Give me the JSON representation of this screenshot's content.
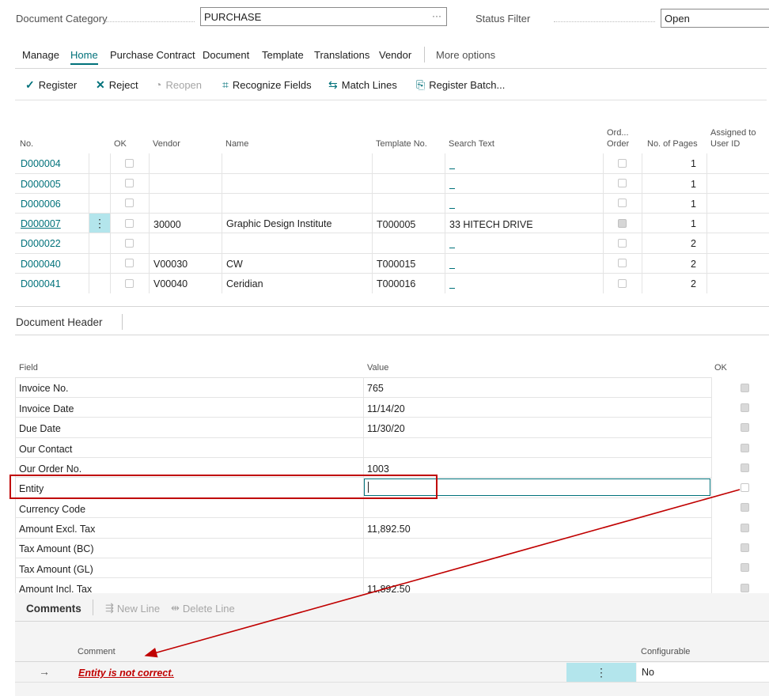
{
  "filters": {
    "doc_category_label": "Document Category",
    "doc_category_value": "PURCHASE",
    "doc_category_more": "···",
    "status_filter_label": "Status Filter",
    "status_filter_value": "Open"
  },
  "tabs": [
    "Manage",
    "Home",
    "Purchase Contract",
    "Document",
    "Template",
    "Translations",
    "Vendor",
    "More options"
  ],
  "active_tab": "Home",
  "actions": {
    "register": "Register",
    "reject": "Reject",
    "reopen": "Reopen",
    "recognize_fields": "Recognize Fields",
    "match_lines": "Match Lines",
    "register_batch": "Register Batch..."
  },
  "documents_table": {
    "headers": {
      "no": "No.",
      "ok": "OK",
      "vendor": "Vendor",
      "name": "Name",
      "template_no": "Template No.",
      "search_text": "Search Text",
      "order_top": "Ord...",
      "order_bottom": "Order",
      "no_of_pages": "No. of Pages",
      "assigned_top": "Assigned to",
      "assigned_bottom": "User ID"
    },
    "rows": [
      {
        "no": "D000004",
        "ok": false,
        "vendor": "",
        "name": "",
        "template_no": "",
        "search_text": "",
        "order": false,
        "pages": "1"
      },
      {
        "no": "D000005",
        "ok": false,
        "vendor": "",
        "name": "",
        "template_no": "",
        "search_text": "",
        "order": false,
        "pages": "1"
      },
      {
        "no": "D000006",
        "ok": false,
        "vendor": "",
        "name": "",
        "template_no": "",
        "search_text": "",
        "order": false,
        "pages": "1"
      },
      {
        "no": "D000007",
        "ok": false,
        "vendor": "30000",
        "name": "Graphic Design Institute",
        "template_no": "T000005",
        "search_text": "33 HITECH DRIVE",
        "order": true,
        "pages": "1"
      },
      {
        "no": "D000022",
        "ok": false,
        "vendor": "",
        "name": "",
        "template_no": "",
        "search_text": "",
        "order": false,
        "pages": "2"
      },
      {
        "no": "D000040",
        "ok": false,
        "vendor": "V00030",
        "name": "CW",
        "template_no": "T000015",
        "search_text": "",
        "order": false,
        "pages": "2"
      },
      {
        "no": "D000041",
        "ok": false,
        "vendor": "V00040",
        "name": "Ceridian",
        "template_no": "T000016",
        "search_text": "",
        "order": false,
        "pages": "2"
      }
    ],
    "row_menu": "⋮"
  },
  "document_header": {
    "title": "Document Header",
    "col_field": "Field",
    "col_value": "Value",
    "col_ok": "OK",
    "rows": [
      {
        "field": "Invoice No.",
        "value": "765",
        "ok": true
      },
      {
        "field": "Invoice Date",
        "value": "11/14/20",
        "ok": true
      },
      {
        "field": "Due Date",
        "value": "11/30/20",
        "ok": true
      },
      {
        "field": "Our Contact",
        "value": "",
        "ok": true
      },
      {
        "field": "Our Order No.",
        "value": "1003",
        "ok": true
      },
      {
        "field": "Entity",
        "value": "",
        "ok": false
      },
      {
        "field": "Currency Code",
        "value": "",
        "ok": true
      },
      {
        "field": "Amount Excl. Tax",
        "value": "11,892.50",
        "ok": true
      },
      {
        "field": "Tax Amount (BC)",
        "value": "",
        "ok": true
      },
      {
        "field": "Tax Amount (GL)",
        "value": "",
        "ok": true
      },
      {
        "field": "Amount Incl. Tax",
        "value": "11,892.50",
        "ok": true
      }
    ]
  },
  "comments": {
    "title": "Comments",
    "new_line": "New Line",
    "delete_line": "Delete Line",
    "col_comment": "Comment",
    "col_configurable": "Configurable",
    "row_arrow": "→",
    "row_comment": "Entity is not correct.",
    "row_menu": "⋮",
    "row_configurable": "No"
  },
  "colors": {
    "accent": "#00717a",
    "highlight_red": "#c00000",
    "selected_cell": "#b3e5ec"
  }
}
